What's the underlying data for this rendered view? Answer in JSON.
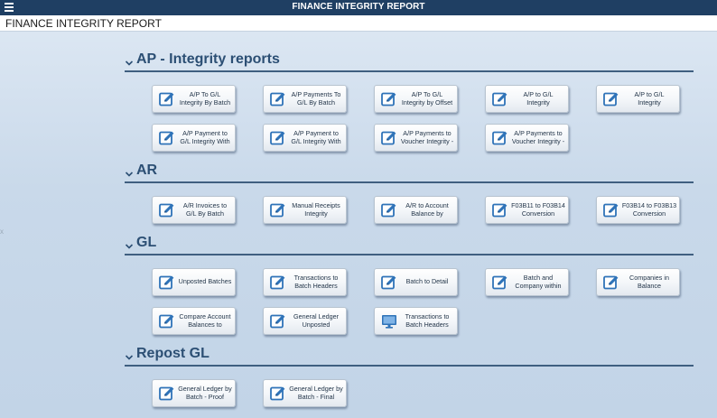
{
  "app": {
    "title": "FINANCE INTEGRITY REPORT"
  },
  "page": {
    "title": "FINANCE INTEGRITY REPORT"
  },
  "side_tab": "x",
  "sections": [
    {
      "label": "AP - Integrity reports",
      "tiles": [
        {
          "line1": "A/P To G/L",
          "line2": "Integrity By Batch",
          "icon": "edit-icon"
        },
        {
          "line1": "A/P Payments To",
          "line2": "G/L By Batch",
          "icon": "edit-icon"
        },
        {
          "line1": "A/P To G/L",
          "line2": "Integrity by Offset",
          "icon": "edit-icon"
        },
        {
          "line1": "A/P to G/L",
          "line2": "Integrity",
          "icon": "edit-icon"
        },
        {
          "line1": "A/P to G/L",
          "line2": "Integrity",
          "icon": "edit-icon"
        },
        {
          "line1": "A/P Payment to",
          "line2": "G/L Integrity With",
          "icon": "edit-icon"
        },
        {
          "line1": "A/P Payment to",
          "line2": "G/L Integrity With",
          "icon": "edit-icon"
        },
        {
          "line1": "A/P Payments to",
          "line2": "Voucher Integrity -",
          "icon": "edit-icon"
        },
        {
          "line1": "A/P Payments to",
          "line2": "Voucher Integrity -",
          "icon": "edit-icon"
        }
      ]
    },
    {
      "label": "AR",
      "tiles": [
        {
          "line1": "A/R Invoices to",
          "line2": "G/L By Batch",
          "icon": "edit-icon"
        },
        {
          "line1": "Manual Receipts",
          "line2": "Integrity",
          "icon": "edit-icon"
        },
        {
          "line1": "A/R to Account",
          "line2": "Balance by",
          "icon": "edit-icon"
        },
        {
          "line1": "F03B11 to F03B14",
          "line2": "Conversion",
          "icon": "edit-icon"
        },
        {
          "line1": "F03B14 to F03B13",
          "line2": "Conversion",
          "icon": "edit-icon"
        }
      ]
    },
    {
      "label": "GL",
      "tiles": [
        {
          "line1": "Unposted Batches",
          "line2": "",
          "icon": "edit-icon"
        },
        {
          "line1": "Transactions to",
          "line2": "Batch Headers",
          "icon": "edit-icon"
        },
        {
          "line1": "Batch to Detail",
          "line2": "",
          "icon": "edit-icon"
        },
        {
          "line1": "Batch and",
          "line2": "Company within",
          "icon": "edit-icon"
        },
        {
          "line1": "Companies in",
          "line2": "Balance",
          "icon": "edit-icon"
        },
        {
          "line1": "Compare Account",
          "line2": "Balances to",
          "icon": "edit-icon"
        },
        {
          "line1": "General Ledger",
          "line2": "Unposted",
          "icon": "edit-icon"
        },
        {
          "line1": "Transactions to",
          "line2": "Batch Headers",
          "icon": "monitor-icon"
        }
      ]
    },
    {
      "label": "Repost GL",
      "tiles": [
        {
          "line1": "General Ledger by",
          "line2": "Batch - Proof",
          "icon": "edit-icon"
        },
        {
          "line1": "General Ledger by",
          "line2": "Batch - Final",
          "icon": "edit-icon"
        }
      ]
    }
  ],
  "colors": {
    "topbar": "#1f3f63",
    "section_title": "#2c4f74",
    "icon_blue": "#2f73b8"
  }
}
